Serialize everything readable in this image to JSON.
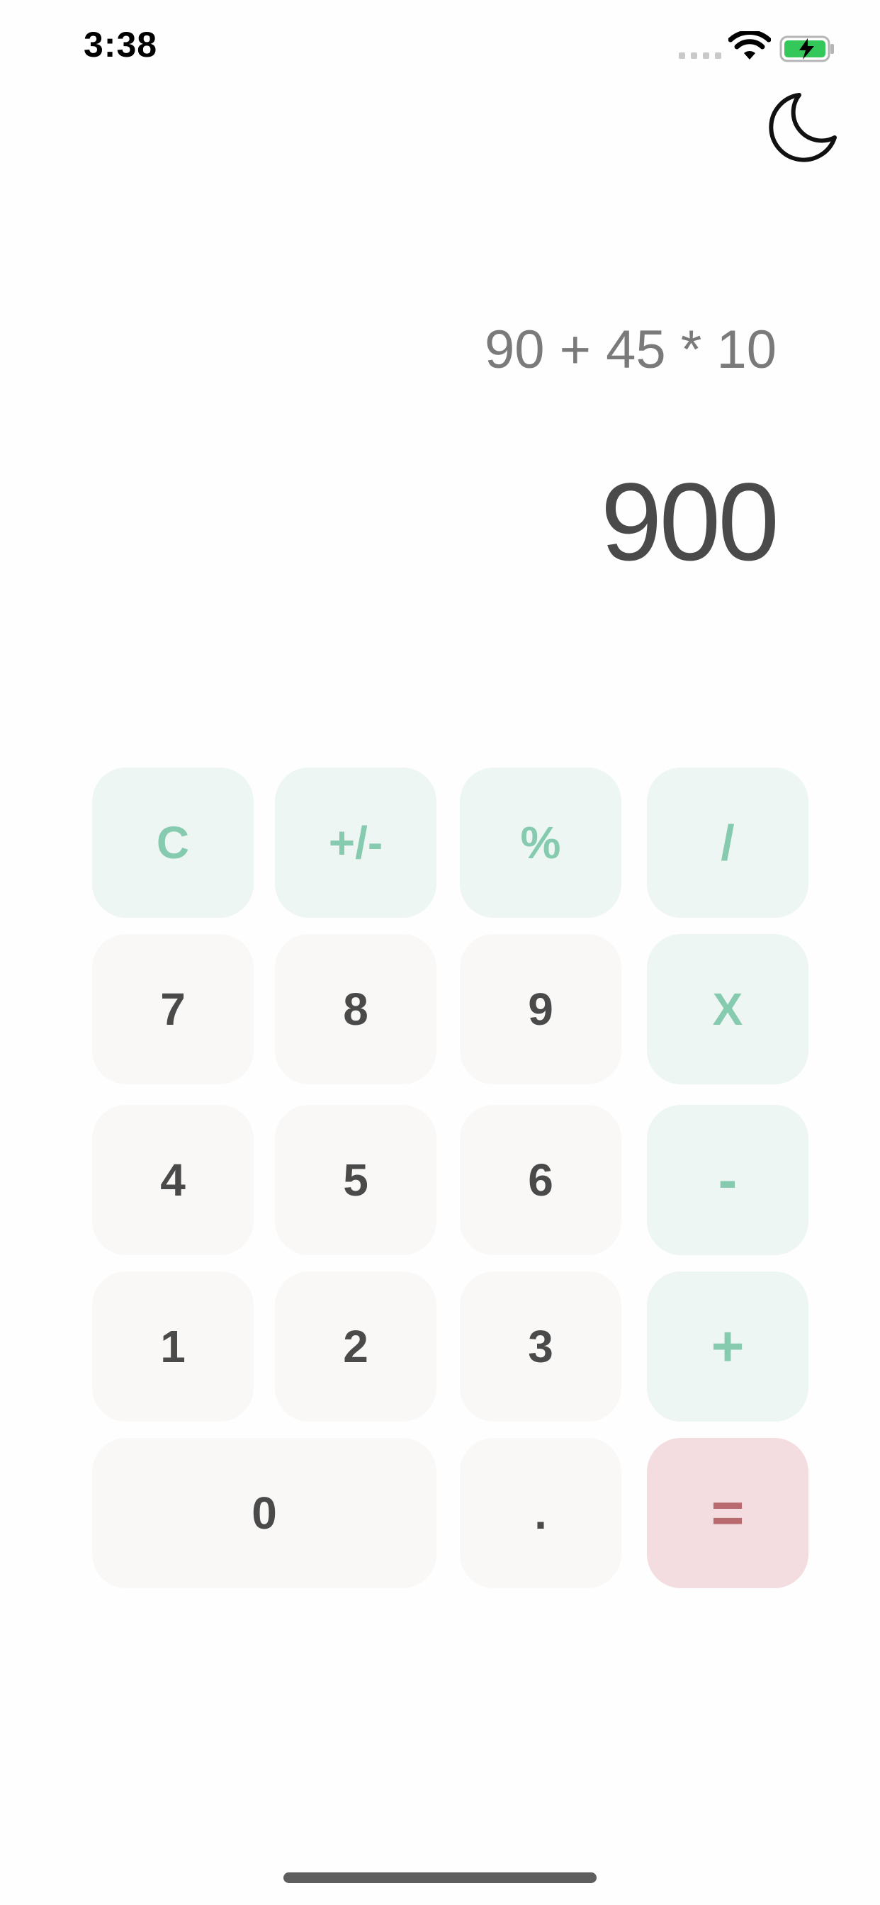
{
  "status_bar": {
    "time": "3:38",
    "wifi_icon": "wifi-icon",
    "battery_icon": "battery-charging-icon",
    "battery_color": "#34c759"
  },
  "header": {
    "theme_toggle_icon": "moon-icon"
  },
  "display": {
    "expression": "90 + 45 * 10",
    "result": "900"
  },
  "keypad": {
    "clear": "C",
    "sign": "+/-",
    "percent": "%",
    "divide": "/",
    "seven": "7",
    "eight": "8",
    "nine": "9",
    "multiply": "X",
    "four": "4",
    "five": "5",
    "six": "6",
    "subtract": "-",
    "one": "1",
    "two": "2",
    "three": "3",
    "add": "+",
    "zero": "0",
    "decimal": ".",
    "equals": "="
  },
  "colors": {
    "function_key_bg": "#edf6f2",
    "function_key_text": "#86cbb0",
    "number_key_bg": "#f9f8f7",
    "number_key_text": "#4a4a4a",
    "equals_key_bg": "#f3dde0",
    "equals_key_text": "#b86a6e"
  }
}
